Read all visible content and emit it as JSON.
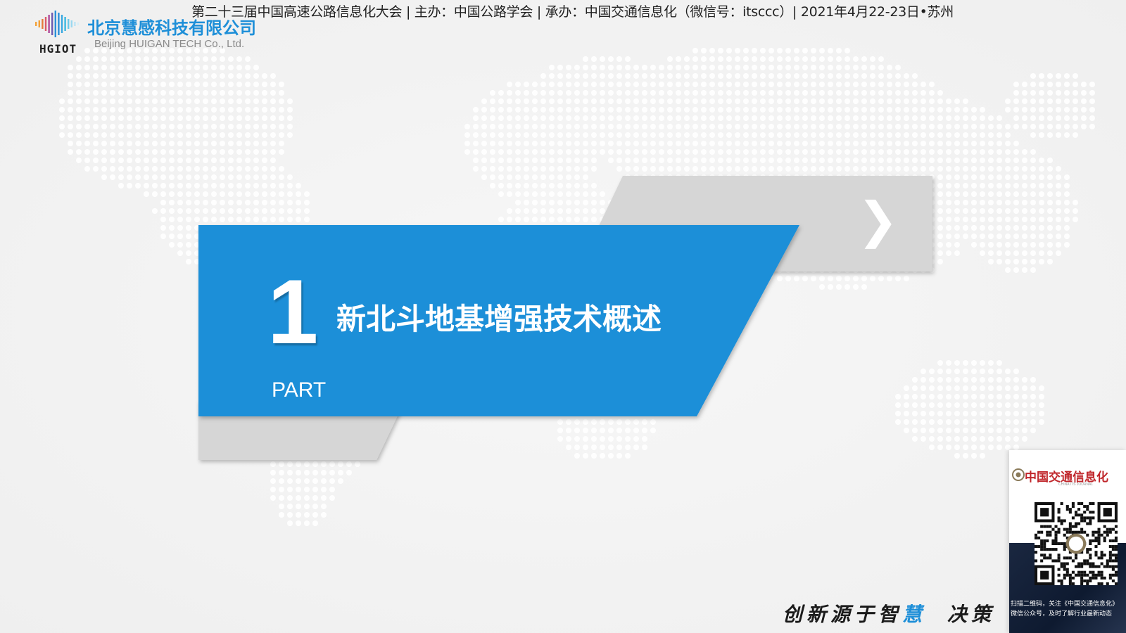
{
  "conference_banner": "第二十三届中国高速公路信息化大会 | 主办：中国公路学会 | 承办：中国交通信息化（微信号：itsccc）| 2021年4月22-23日•苏州",
  "logo": {
    "brand_mark": "HGIOT",
    "company_cn": "北京慧感科技有限公司",
    "company_en": "Beijing  HUIGAN TECH  Co., Ltd.",
    "accent_color": "#1e8fd8"
  },
  "section": {
    "number": "1",
    "title": "新北斗地基增强技术概述",
    "label": "PART",
    "panel_color": "#1e8fd8",
    "gray_color": "#d6d6d6",
    "arrow_icon": "chevron-right-icon"
  },
  "slogan": {
    "part1": "创新源于智",
    "highlight": "慧",
    "part2": "决策"
  },
  "qr_card": {
    "brand": "中国交通信息化",
    "brand_sub": "CHINA ITS JOURNAL",
    "caption_line1": "扫描二维码，关注《中国交通信息化》",
    "caption_line2": "微信公众号，及时了解行业最新动态",
    "brand_color": "#c0262b"
  }
}
